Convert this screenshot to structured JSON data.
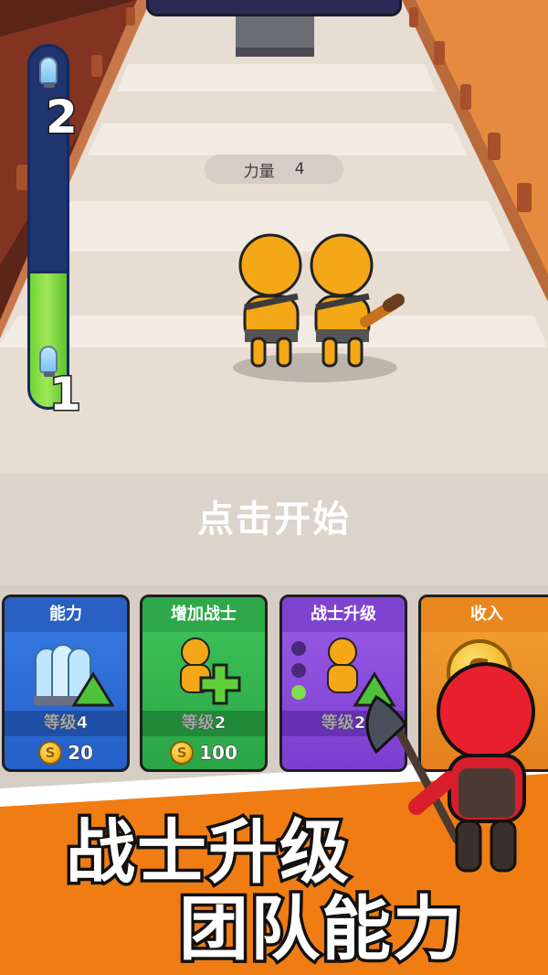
{
  "hud": {
    "progress": {
      "current_level": "1",
      "next_level": "2",
      "fill_fraction": 0.37
    },
    "power": {
      "label": "力量",
      "value": "4"
    }
  },
  "prompt": {
    "tap_to_start": "点击开始"
  },
  "upgrades": [
    {
      "title": "能力",
      "level_label": "等级",
      "level": "4",
      "cost": "20",
      "color": "#2a6ad6"
    },
    {
      "title": "增加战士",
      "level_label": "等级",
      "level": "2",
      "cost": "100",
      "color": "#2fb04e"
    },
    {
      "title": "战士升级",
      "level_label": "等级",
      "level": "2",
      "cost": "",
      "color": "#8448d8"
    },
    {
      "title": "收入",
      "level_label": "",
      "level": "",
      "cost": "",
      "color": "#ea8a22"
    }
  ],
  "banner": {
    "line1": "战士升级",
    "line2": "团队能力"
  },
  "colors": {
    "track": "#e9e1d8",
    "banner_orange": "#f07d14",
    "progress_blue": "#20356f",
    "progress_green": "#7fdc45"
  },
  "icons": [
    "glass-dome-icon",
    "up-arrow-icon",
    "plus-icon",
    "coin-icon",
    "warrior-icon",
    "axe-icon"
  ]
}
